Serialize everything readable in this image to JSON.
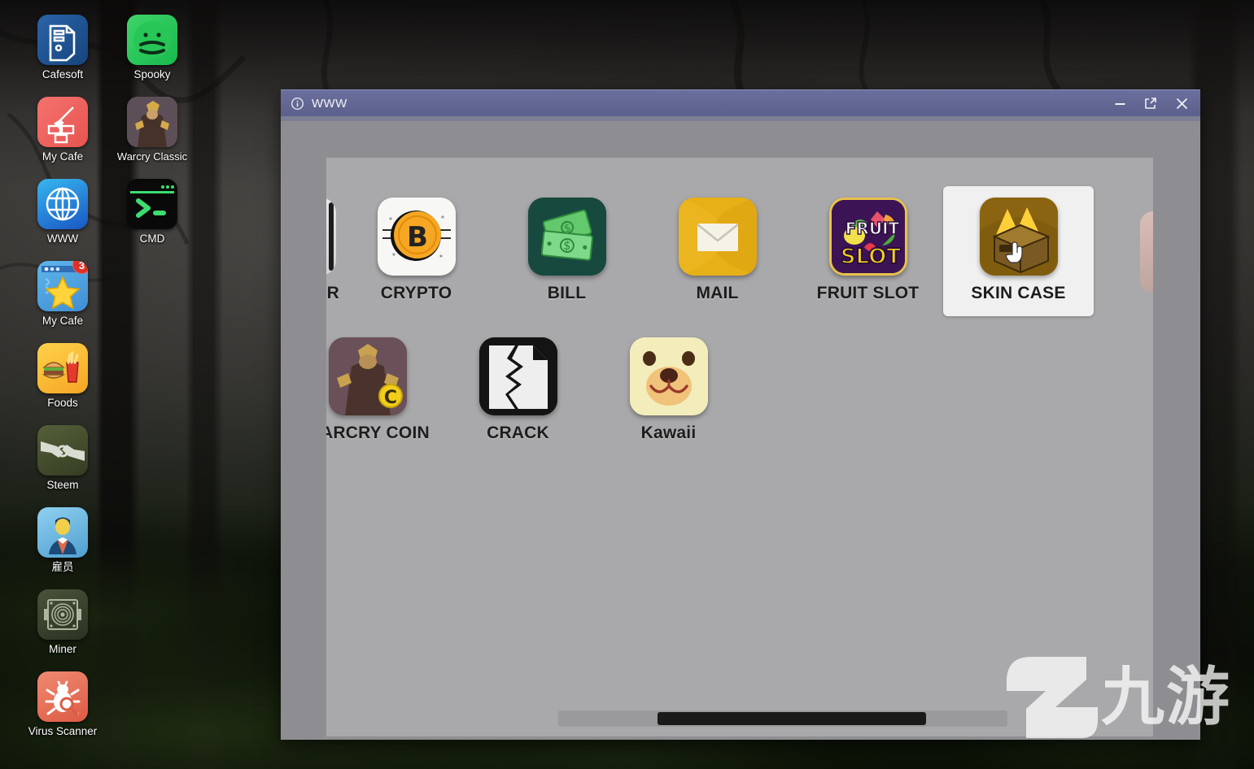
{
  "desktop": {
    "icons": [
      {
        "label": "Cafesoft",
        "icon": "desktop-tower-icon",
        "badge": null
      },
      {
        "label": "Spooky",
        "icon": "spooky-face-icon",
        "badge": null
      },
      {
        "label": "My Cafe",
        "icon": "paint-brush-bricks-icon",
        "badge": null
      },
      {
        "label": "Warcry Classic",
        "icon": "warrior-portrait-icon",
        "badge": null
      },
      {
        "label": "WWW",
        "icon": "globe-icon",
        "badge": null
      },
      {
        "label": "CMD",
        "icon": "terminal-prompt-icon",
        "badge": null
      },
      {
        "label": "My Cafe",
        "icon": "star-window-icon",
        "badge": "3"
      },
      {
        "label": "Foods",
        "icon": "burger-fries-icon",
        "badge": null
      },
      {
        "label": "Steem",
        "icon": "handshake-icon",
        "badge": null
      },
      {
        "label": "雇员",
        "icon": "employee-person-icon",
        "badge": null
      },
      {
        "label": "Miner",
        "icon": "cpu-fan-icon",
        "badge": null
      },
      {
        "label": "Virus Scanner",
        "icon": "bug-magnifier-icon",
        "badge": null
      }
    ]
  },
  "window": {
    "title": "WWW",
    "title_icon": "info-circle-icon",
    "controls": {
      "minimize": "minimize-icon",
      "maximize": "external-link-icon",
      "close": "close-icon"
    }
  },
  "browser": {
    "apps": [
      {
        "name": "CRYPTO",
        "icon": "bitcoin-coin-icon",
        "selected": false
      },
      {
        "name": "BILL",
        "icon": "dollar-bills-icon",
        "selected": false
      },
      {
        "name": "MAIL",
        "icon": "envelope-icon",
        "selected": false
      },
      {
        "name": "FRUIT SLOT",
        "icon": "fruit-slot-machine-icon",
        "selected": false
      },
      {
        "name": "SKIN CASE",
        "icon": "weapon-crate-icon",
        "selected": true
      },
      {
        "name": "WARCRY COIN",
        "icon": "warcry-coin-icon",
        "selected": false
      },
      {
        "name": "CRACK",
        "icon": "cracked-file-icon",
        "selected": false
      },
      {
        "name": "Kawaii",
        "icon": "bear-face-icon",
        "selected": false
      }
    ],
    "clipped_left_label": "R",
    "scrollbar": {
      "name": "horizontal-scrollbar"
    }
  },
  "watermark": {
    "text": "九游",
    "logo": "jiuyou-logo-icon"
  },
  "colors": {
    "titlebar": "#636793",
    "window_body": "#8e8e92",
    "content_pane": "#a9a9ab",
    "selection": "#f0f0f0",
    "badge": "#e03025"
  }
}
